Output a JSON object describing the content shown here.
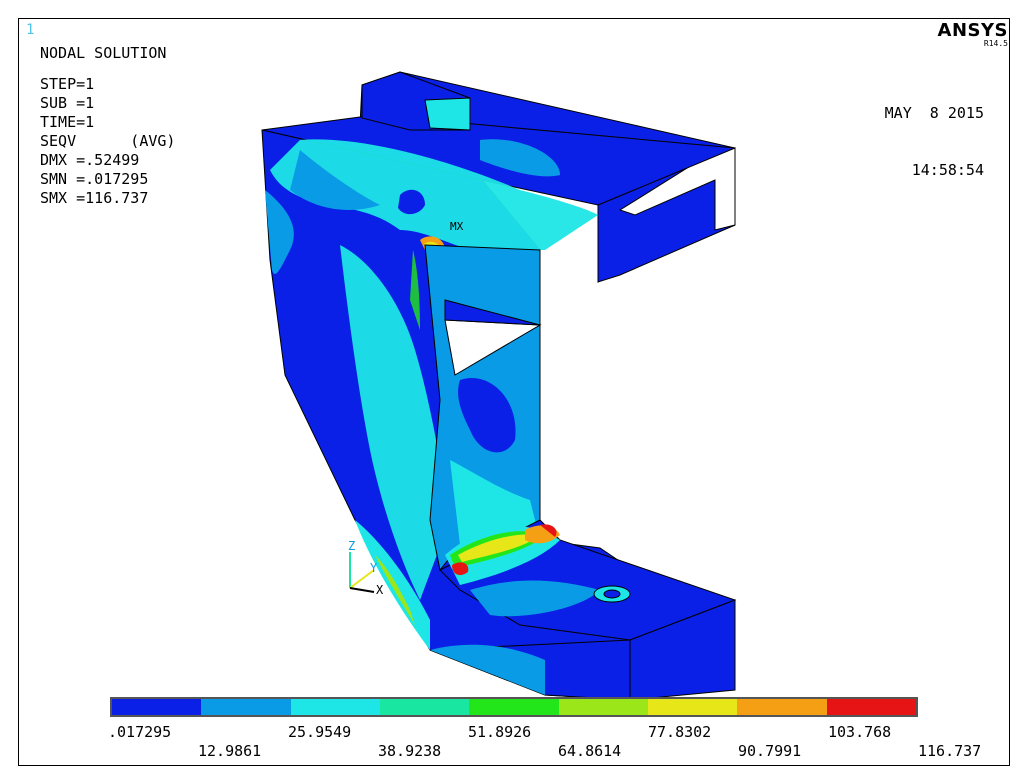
{
  "window_number": "1",
  "solution": {
    "title": "NODAL SOLUTION",
    "lines": [
      "STEP=1",
      "SUB =1",
      "TIME=1",
      "SEQV      (AVG)",
      "DMX =.52499",
      "SMN =.017295",
      "SMX =116.737"
    ]
  },
  "brand": {
    "logo": "ANSYS",
    "version": "R14.5"
  },
  "timestamp": {
    "date": "MAY  8 2015",
    "time": "14:58:54"
  },
  "max_marker": "MX",
  "triad": {
    "z": "Z",
    "y": "Y",
    "x": "X"
  },
  "legend": {
    "colors": [
      "#0a20e6",
      "#0a9be6",
      "#1ee6e6",
      "#19e6a0",
      "#22e619",
      "#9be619",
      "#e6e619",
      "#f5a014",
      "#e61414"
    ],
    "ticks_top": [
      ".017295",
      "25.9549",
      "51.8926",
      "77.8302",
      "103.768"
    ],
    "ticks_bottom": [
      "12.9861",
      "38.9238",
      "64.8614",
      "90.7991",
      "116.737"
    ]
  }
}
